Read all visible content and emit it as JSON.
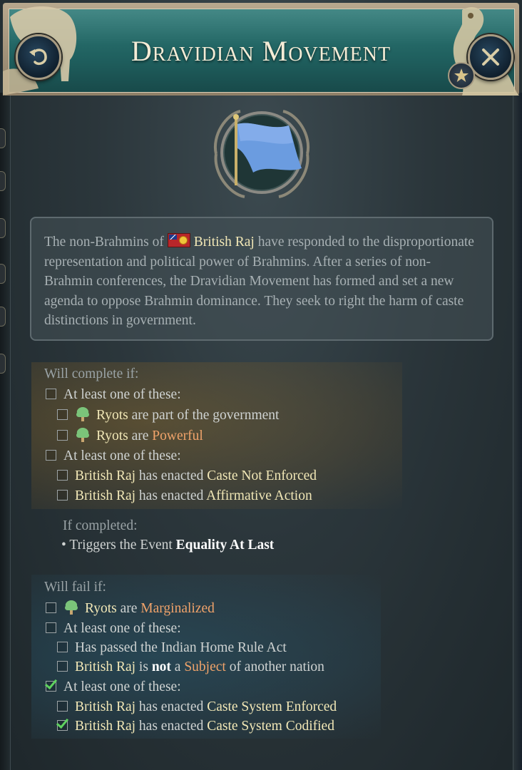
{
  "header": {
    "title": "Dravidian Movement"
  },
  "description": {
    "before_country": "The non-Brahmins of",
    "country": "British Raj",
    "after_country": "have responded to the disproportionate representation and political power of Brahmins. After a series of non-Brahmin conferences, the Dravidian Movement has formed and set a new agenda to oppose Brahmin dominance. They seek to right the harm of caste distinctions in government."
  },
  "complete": {
    "heading": "Will complete if:",
    "group1": "At least one of these:",
    "ryots": "Ryots",
    "part_of_government": "are part of the government",
    "are": "are",
    "powerful": "Powerful",
    "group2": "At least one of these:",
    "country": "British Raj",
    "has_enacted": "has enacted",
    "law1": "Caste Not Enforced",
    "law2": "Affirmative Action"
  },
  "on_complete": {
    "heading": "If completed:",
    "bullet": "•",
    "triggers": "Triggers the Event",
    "event": "Equality At Last"
  },
  "fail": {
    "heading": "Will fail if:",
    "ryots": "Ryots",
    "are": "are",
    "marginalized": "Marginalized",
    "group1": "At least one of these:",
    "home_rule": "Has passed the Indian Home Rule Act",
    "country": "British Raj",
    "is": "is",
    "not": "not",
    "a": "a",
    "subject": "Subject",
    "of_another_nation": "of another nation",
    "group2": "At least one of these:",
    "has_enacted": "has enacted",
    "law1": "Caste System Enforced",
    "law2": "Caste System Codified"
  },
  "colors": {
    "header_teal": "#1f5f5e",
    "highlight_yellow": "#f1e7b6",
    "negative_orange": "#f0a36a",
    "check_green": "#5fd25f"
  },
  "icons": {
    "back": "back-arrow-icon",
    "close": "close-x-icon",
    "star": "star-icon",
    "flag": "flag-icon",
    "tree": "tree-icon"
  }
}
